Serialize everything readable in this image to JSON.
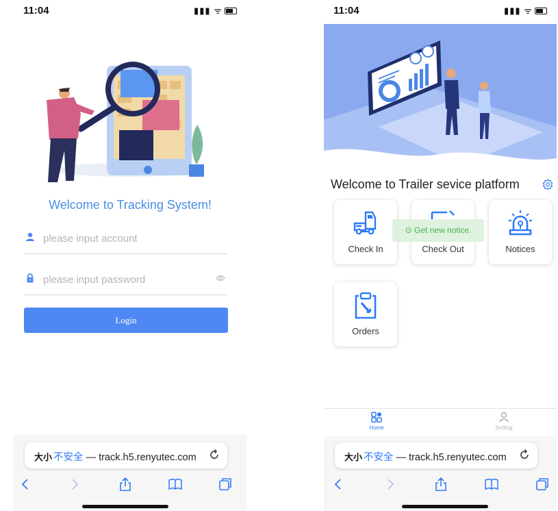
{
  "status_bar": {
    "time": "11:04",
    "signal_icon": "signal-wifi-battery-icons"
  },
  "login": {
    "title": "Welcome to Tracking System!",
    "account_placeholder": "please input account",
    "password_placeholder": "please input password",
    "login_label": "Login",
    "accent_color": "#4f88f2"
  },
  "home": {
    "title": "Welcome to Trailer sevice platform",
    "toast": "Get new notice.",
    "cards": [
      {
        "label": "Check In",
        "icon": "truck-check-in-icon"
      },
      {
        "label": "Check Out",
        "icon": "check-out-icon"
      },
      {
        "label": "Notices",
        "icon": "alarm-notice-icon"
      },
      {
        "label": "Orders",
        "icon": "clipboard-wrench-icon"
      }
    ],
    "tabs": [
      {
        "label": "Home",
        "icon": "grid-home-icon",
        "active": true
      },
      {
        "label": "Setting",
        "icon": "user-setting-icon",
        "active": false
      }
    ]
  },
  "browser": {
    "text_size_label": "大小",
    "insecure_label": "不安全",
    "separator": "—",
    "domain": "track.h5.renyutec.com"
  }
}
